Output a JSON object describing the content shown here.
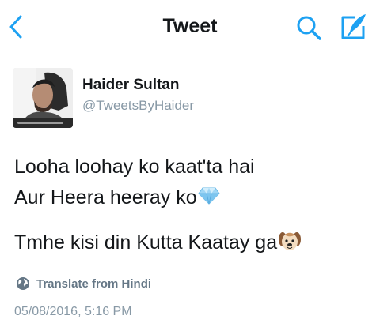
{
  "header": {
    "title": "Tweet",
    "back_icon": "chevron-left-icon",
    "search_icon": "search-icon",
    "compose_icon": "compose-icon",
    "accent_color": "#1da1f2"
  },
  "author": {
    "name": "Haider Sultan",
    "handle": "@TweetsByHaider"
  },
  "tweet": {
    "line1": "Looha loohay ko kaat'ta hai",
    "line2": "Aur Heera heeray ko",
    "line2_emoji": "gem-emoji",
    "line3": "Tmhe kisi din Kutta Kaatay ga",
    "line3_emoji": "dog-face-emoji"
  },
  "translate": {
    "label": "Translate from Hindi",
    "icon": "globe-icon"
  },
  "timestamp": "05/08/2016, 5:16 PM"
}
